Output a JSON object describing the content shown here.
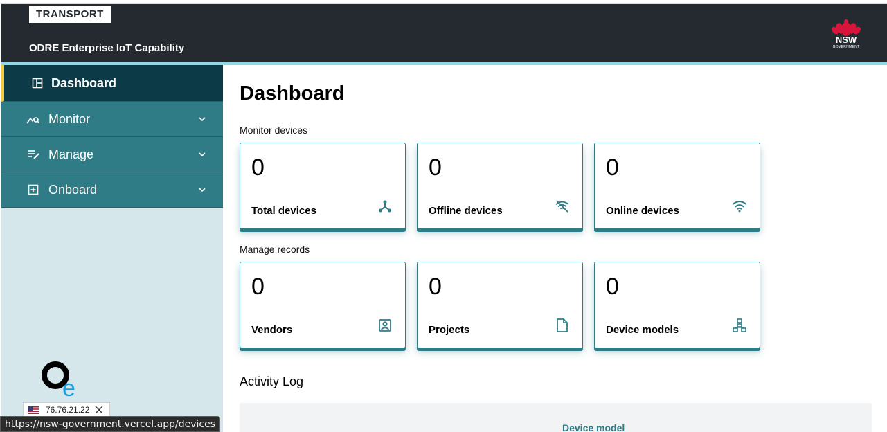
{
  "header": {
    "brand_tag": "TRANSPORT",
    "app_title": "ODRE Enterprise IoT Capability",
    "logo_text": "NSW",
    "logo_subtext": "GOVERNMENT"
  },
  "sidebar": {
    "items": [
      {
        "label": "Dashboard",
        "icon": "dashboard-icon",
        "active": true
      },
      {
        "label": "Monitor",
        "icon": "monitor-chart-icon",
        "expandable": true
      },
      {
        "label": "Manage",
        "icon": "manage-list-icon",
        "expandable": true
      },
      {
        "label": "Onboard",
        "icon": "add-box-icon",
        "expandable": true
      }
    ],
    "ip_badge": "76.76.21.22",
    "url_tooltip": "https://nsw-government.vercel.app/devices"
  },
  "main": {
    "title": "Dashboard",
    "monitor_section": "Monitor devices",
    "manage_section": "Manage records",
    "monitor_cards": [
      {
        "value": "0",
        "label": "Total devices",
        "icon": "hub-icon"
      },
      {
        "value": "0",
        "label": "Offline devices",
        "icon": "wifi-off-icon"
      },
      {
        "value": "0",
        "label": "Online devices",
        "icon": "wifi-icon"
      }
    ],
    "manage_cards": [
      {
        "value": "0",
        "label": "Vendors",
        "icon": "contact-icon"
      },
      {
        "value": "0",
        "label": "Projects",
        "icon": "document-icon"
      },
      {
        "value": "0",
        "label": "Device models",
        "icon": "hierarchy-icon"
      }
    ],
    "activity_title": "Activity Log",
    "activity_column": "Device model"
  },
  "colors": {
    "header_bg": "#242a30",
    "accent": "#2f7c86",
    "sidebar_active": "#0c3a47",
    "active_marker": "#f2cc3d",
    "sidebar_bg": "#d5e7ea"
  }
}
